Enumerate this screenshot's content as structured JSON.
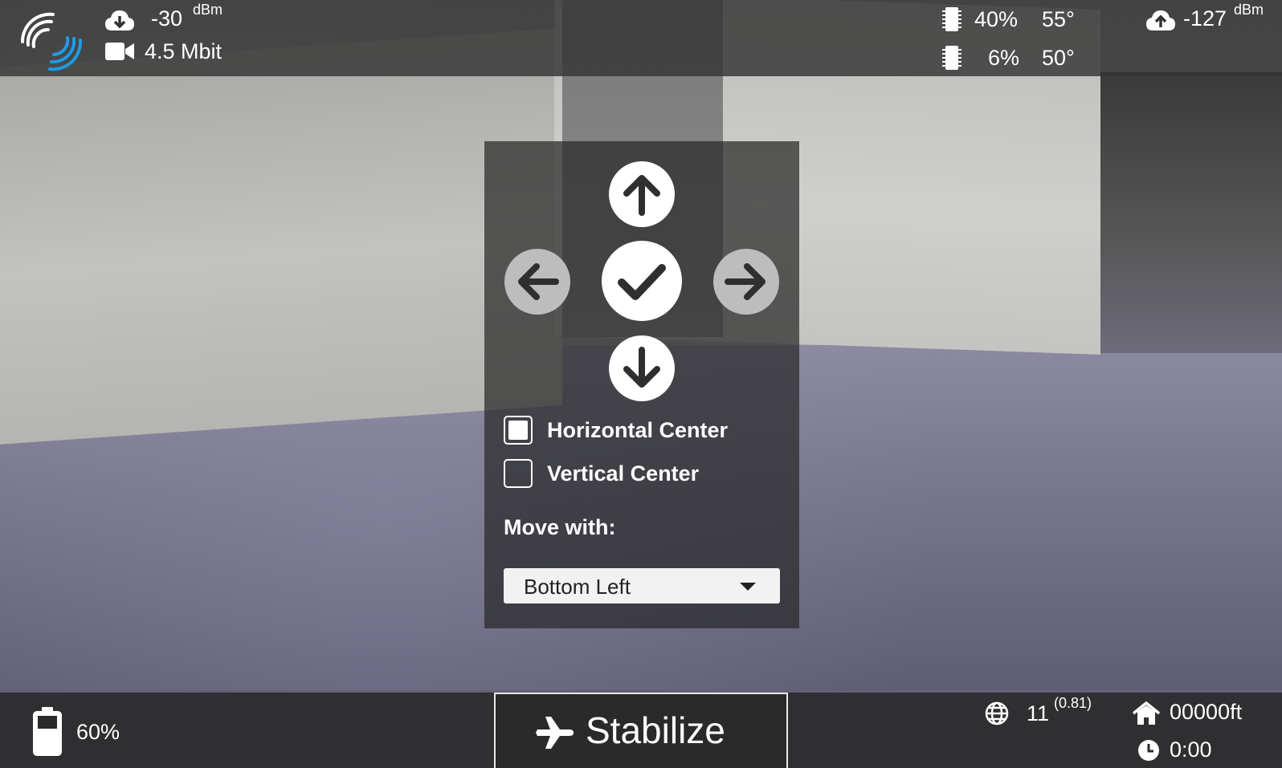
{
  "top_bar": {
    "downlink_signal": "-30",
    "downlink_unit": "dBm",
    "video_bitrate": "4.5 Mbit",
    "board1_percent": "40%",
    "board1_temp": "55°",
    "board2_percent": "6%",
    "board2_temp": "50°",
    "uplink_signal": "-127",
    "uplink_unit": "dBm"
  },
  "panel": {
    "horizontal_center_label": "Horizontal Center",
    "horizontal_center_checked": true,
    "vertical_center_label": "Vertical Center",
    "vertical_center_checked": false,
    "move_with_label": "Move with:",
    "move_with_selected": "Bottom Left"
  },
  "bottom_bar": {
    "battery_percent": "60%",
    "flight_mode": "Stabilize",
    "gps_sats": "11",
    "gps_hdop": "(0.81)",
    "home_distance": "00000ft",
    "flight_time": "0:00"
  },
  "colors": {
    "accent_blue": "#1e9be6",
    "bar_background": "#343434",
    "text": "#ffffff"
  },
  "icons": {
    "link": "wifi-link-icon",
    "download": "cloud-download-icon",
    "video": "video-camera-icon",
    "memory": "memory-chip-icon",
    "upload": "cloud-upload-icon",
    "battery": "battery-icon",
    "mode": "airplane-icon",
    "gps": "globe-icon",
    "home": "home-icon",
    "clock": "clock-icon"
  }
}
